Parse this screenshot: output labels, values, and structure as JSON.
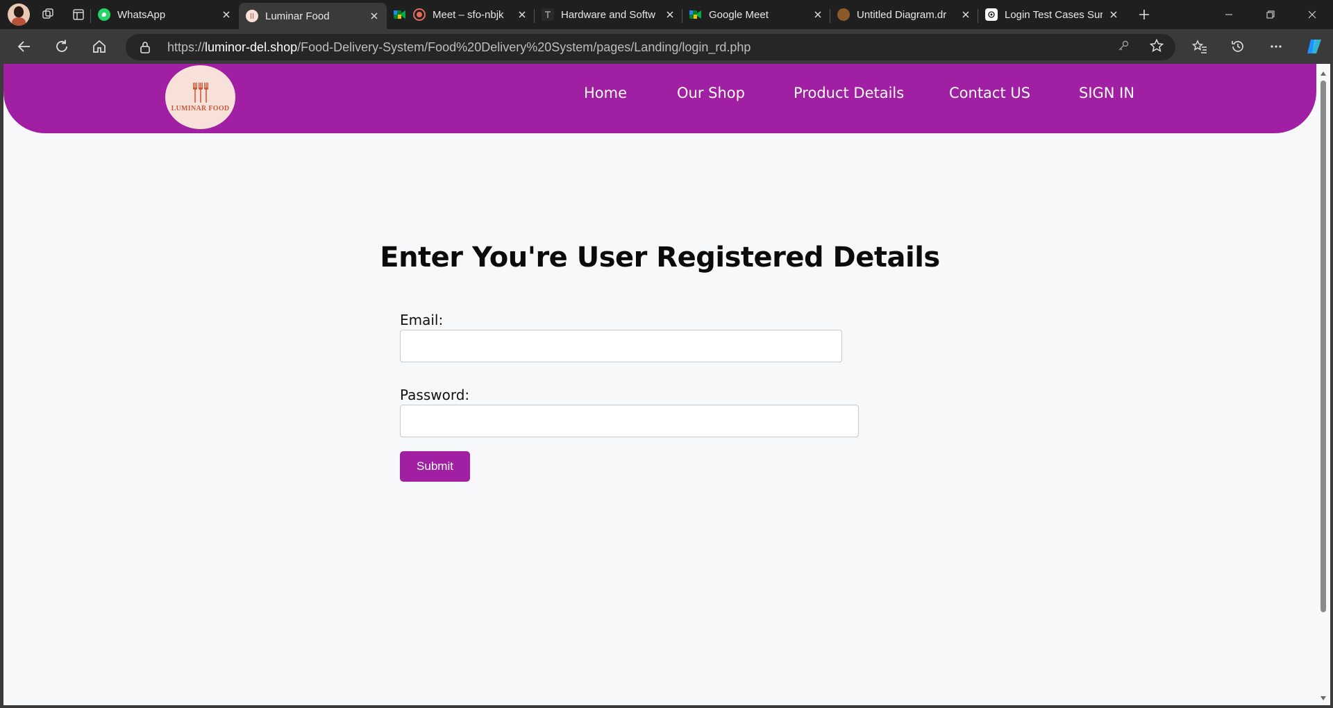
{
  "browser": {
    "tabs": [
      {
        "title": "WhatsApp",
        "icon": "whatsapp-icon",
        "active": false
      },
      {
        "title": "Luminar Food",
        "icon": "luminar-food-favicon",
        "active": true
      },
      {
        "title": "Meet – sfo-nbjk",
        "icon": "google-meet-icon",
        "active": false
      },
      {
        "title": "Hardware and Softw",
        "icon": "document-favicon",
        "active": false
      },
      {
        "title": "Google Meet",
        "icon": "google-meet-icon",
        "active": false
      },
      {
        "title": "Untitled Diagram.dr",
        "icon": "drawio-favicon",
        "active": false
      },
      {
        "title": "Login Test Cases Sur",
        "icon": "chatgpt-icon",
        "active": false
      }
    ],
    "url_scheme": "https://",
    "url_host": "luminor-del.shop",
    "url_path": "/Food-Delivery-System/Food%20Delivery%20System/pages/Landing/login_rd.php"
  },
  "site": {
    "logo_text": "LUMINAR FOOD",
    "nav": [
      "Home",
      "Our Shop",
      "Product Details",
      "Contact US",
      "SIGN IN"
    ],
    "brand_color": "#a11fa3"
  },
  "form": {
    "heading": "Enter You're User Registered Details",
    "email_label": "Email:",
    "email_value": "",
    "password_label": "Password:",
    "password_value": "",
    "submit_label": "Submit"
  }
}
